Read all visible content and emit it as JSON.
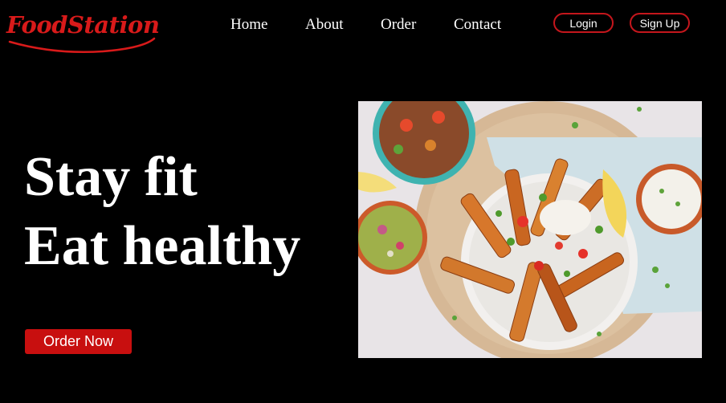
{
  "brand": {
    "name": "FoodStation",
    "color": "#d81a1a"
  },
  "nav": {
    "items": [
      {
        "label": "Home"
      },
      {
        "label": "About"
      },
      {
        "label": "Order"
      },
      {
        "label": "Contact"
      }
    ]
  },
  "auth": {
    "login_label": "Login",
    "signup_label": "Sign Up",
    "border_color": "#c4161c"
  },
  "hero": {
    "line1": "Stay fit",
    "line2": "Eat healthy",
    "cta_label": "Order Now",
    "cta_color": "#c80f0f",
    "image_icon": "food-photo"
  }
}
